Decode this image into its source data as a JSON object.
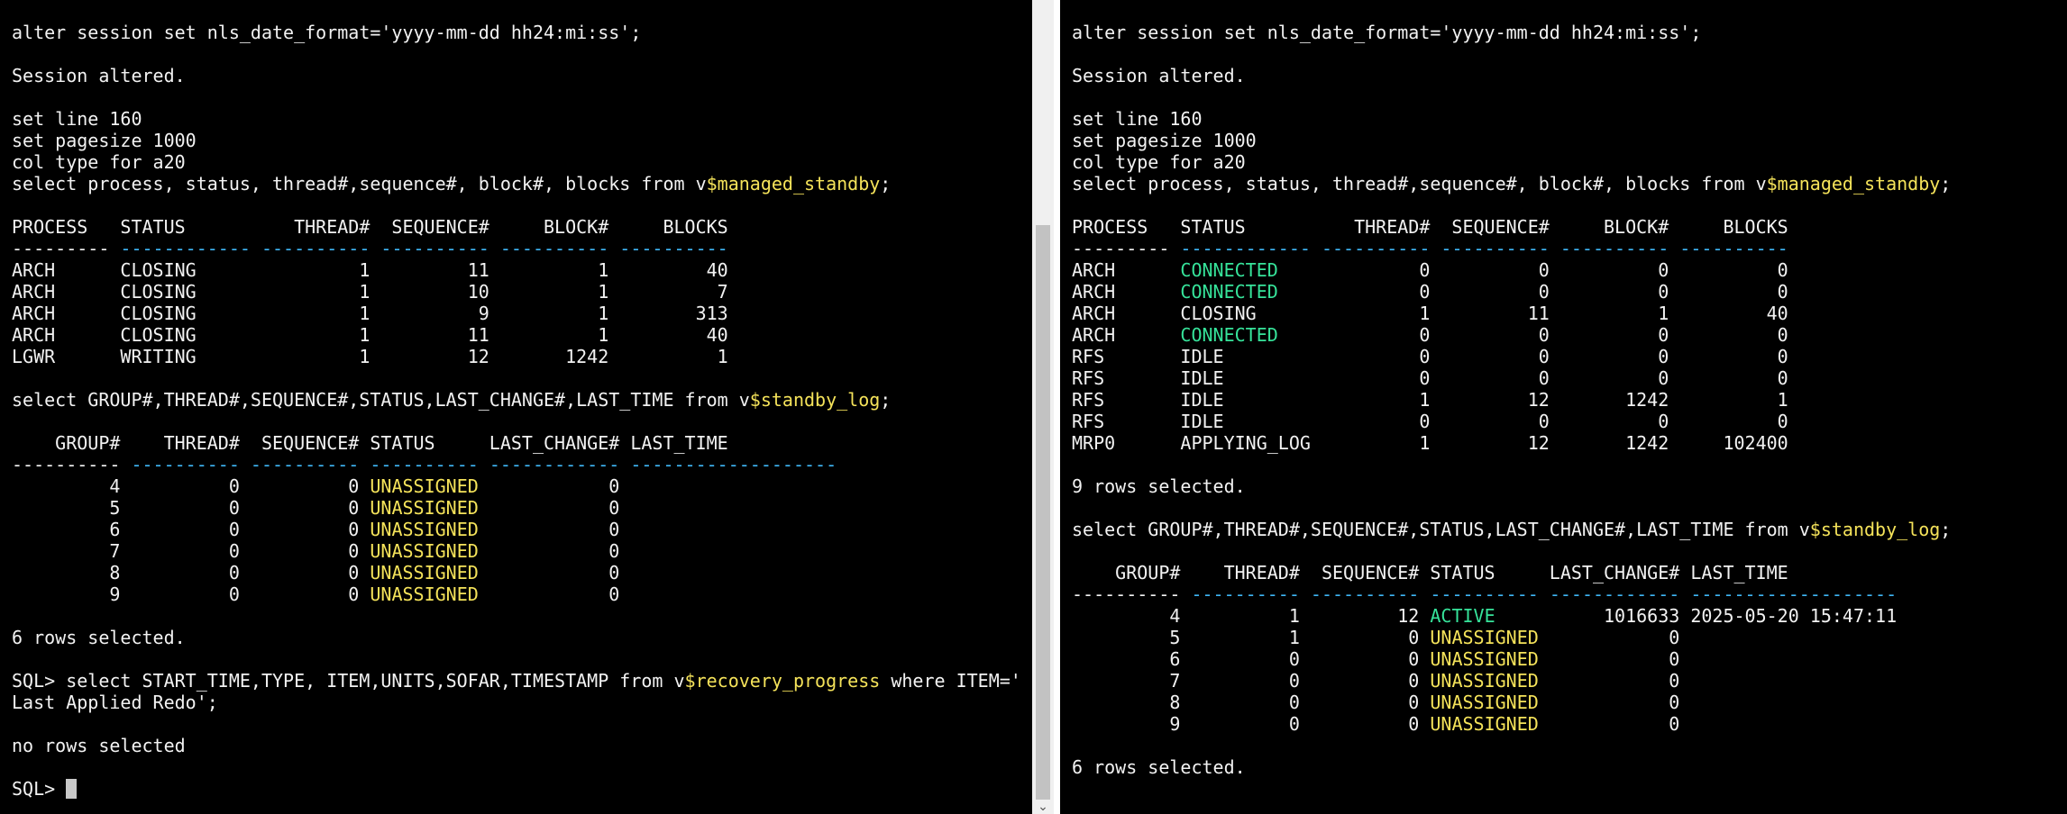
{
  "colors": {
    "background": "#000000",
    "text": "#f2f2f2",
    "highlight_yellow": "#f5e35a",
    "highlight_green": "#36e39a",
    "separator_blue": "#3fb6f5"
  },
  "left_terminal": {
    "lines": [
      [
        {
          "t": "alter session set nls_date_format='yyyy-mm-dd hh24:mi:ss';"
        }
      ],
      [],
      [
        {
          "t": "Session altered."
        }
      ],
      [],
      [
        {
          "t": "set line 160"
        }
      ],
      [
        {
          "t": "set pagesize 1000"
        }
      ],
      [
        {
          "t": "col type for a20"
        }
      ],
      [
        {
          "t": "select process, status, thread#,sequence#, block#, blocks from v"
        },
        {
          "t": "$managed_standby",
          "c": "y"
        },
        {
          "t": ";"
        }
      ],
      [],
      [
        {
          "t": "PROCESS   STATUS          THREAD#  SEQUENCE#     BLOCK#     BLOCKS"
        }
      ],
      [
        {
          "t": "---------"
        },
        {
          "t": " ------------ ---------- ---------- ---------- ----------",
          "c": "d"
        }
      ],
      [
        {
          "t": "ARCH      CLOSING               1         11          1         40"
        }
      ],
      [
        {
          "t": "ARCH      CLOSING               1         10          1          7"
        }
      ],
      [
        {
          "t": "ARCH      CLOSING               1          9          1        313"
        }
      ],
      [
        {
          "t": "ARCH      CLOSING               1         11          1         40"
        }
      ],
      [
        {
          "t": "LGWR      WRITING               1         12       1242          1"
        }
      ],
      [],
      [
        {
          "t": "select GROUP#,THREAD#,SEQUENCE#,STATUS,LAST_CHANGE#,LAST_TIME from v"
        },
        {
          "t": "$standby_log",
          "c": "y"
        },
        {
          "t": ";"
        }
      ],
      [],
      [
        {
          "t": "    GROUP#    THREAD#  SEQUENCE# STATUS     LAST_CHANGE# LAST_TIME"
        }
      ],
      [
        {
          "t": "----------"
        },
        {
          "t": " ---------- ---------- ---------- ------------ -------------------",
          "c": "d"
        }
      ],
      [
        {
          "t": "         4          0          0 "
        },
        {
          "t": "UNASSIGNED",
          "c": "y"
        },
        {
          "t": "            0"
        }
      ],
      [
        {
          "t": "         5          0          0 "
        },
        {
          "t": "UNASSIGNED",
          "c": "y"
        },
        {
          "t": "            0"
        }
      ],
      [
        {
          "t": "         6          0          0 "
        },
        {
          "t": "UNASSIGNED",
          "c": "y"
        },
        {
          "t": "            0"
        }
      ],
      [
        {
          "t": "         7          0          0 "
        },
        {
          "t": "UNASSIGNED",
          "c": "y"
        },
        {
          "t": "            0"
        }
      ],
      [
        {
          "t": "         8          0          0 "
        },
        {
          "t": "UNASSIGNED",
          "c": "y"
        },
        {
          "t": "            0"
        }
      ],
      [
        {
          "t": "         9          0          0 "
        },
        {
          "t": "UNASSIGNED",
          "c": "y"
        },
        {
          "t": "            0"
        }
      ],
      [],
      [
        {
          "t": "6 rows selected."
        }
      ],
      [],
      [
        {
          "t": "SQL> select START_TIME,TYPE, ITEM,UNITS,SOFAR,TIMESTAMP from v"
        },
        {
          "t": "$recovery_progress",
          "c": "y"
        },
        {
          "t": " where ITEM='"
        }
      ],
      [
        {
          "t": "Last Applied Redo';"
        }
      ],
      [],
      [
        {
          "t": "no rows selected"
        }
      ],
      [],
      [
        {
          "t": "SQL> "
        },
        {
          "cursor": true
        }
      ]
    ]
  },
  "right_terminal": {
    "lines": [
      [
        {
          "t": "alter session set nls_date_format='yyyy-mm-dd hh24:mi:ss';"
        }
      ],
      [],
      [
        {
          "t": "Session altered."
        }
      ],
      [],
      [
        {
          "t": "set line 160"
        }
      ],
      [
        {
          "t": "set pagesize 1000"
        }
      ],
      [
        {
          "t": "col type for a20"
        }
      ],
      [
        {
          "t": "select process, status, thread#,sequence#, block#, blocks from v"
        },
        {
          "t": "$managed_standby",
          "c": "y"
        },
        {
          "t": ";"
        }
      ],
      [],
      [
        {
          "t": "PROCESS   STATUS          THREAD#  SEQUENCE#     BLOCK#     BLOCKS"
        }
      ],
      [
        {
          "t": "---------"
        },
        {
          "t": " ------------ ---------- ---------- ---------- ----------",
          "c": "d"
        }
      ],
      [
        {
          "t": "ARCH      "
        },
        {
          "t": "CONNECTED",
          "c": "g"
        },
        {
          "t": "             0          0          0          0"
        }
      ],
      [
        {
          "t": "ARCH      "
        },
        {
          "t": "CONNECTED",
          "c": "g"
        },
        {
          "t": "             0          0          0          0"
        }
      ],
      [
        {
          "t": "ARCH      CLOSING               1         11          1         40"
        }
      ],
      [
        {
          "t": "ARCH      "
        },
        {
          "t": "CONNECTED",
          "c": "g"
        },
        {
          "t": "             0          0          0          0"
        }
      ],
      [
        {
          "t": "RFS       IDLE                  0          0          0          0"
        }
      ],
      [
        {
          "t": "RFS       IDLE                  0          0          0          0"
        }
      ],
      [
        {
          "t": "RFS       IDLE                  1         12       1242          1"
        }
      ],
      [
        {
          "t": "RFS       IDLE                  0          0          0          0"
        }
      ],
      [
        {
          "t": "MRP0      APPLYING_LOG          1         12       1242     102400"
        }
      ],
      [],
      [
        {
          "t": "9 rows selected."
        }
      ],
      [],
      [
        {
          "t": "select GROUP#,THREAD#,SEQUENCE#,STATUS,LAST_CHANGE#,LAST_TIME from v"
        },
        {
          "t": "$standby_log",
          "c": "y"
        },
        {
          "t": ";"
        }
      ],
      [],
      [
        {
          "t": "    GROUP#    THREAD#  SEQUENCE# STATUS     LAST_CHANGE# LAST_TIME"
        }
      ],
      [
        {
          "t": "----------"
        },
        {
          "t": " ---------- ---------- ---------- ------------ -------------------",
          "c": "d"
        }
      ],
      [
        {
          "t": "         4          1         12 "
        },
        {
          "t": "ACTIVE",
          "c": "g"
        },
        {
          "t": "          1016633 2025-05-20 15:47:11"
        }
      ],
      [
        {
          "t": "         5          1          0 "
        },
        {
          "t": "UNASSIGNED",
          "c": "y"
        },
        {
          "t": "            0"
        }
      ],
      [
        {
          "t": "         6          0          0 "
        },
        {
          "t": "UNASSIGNED",
          "c": "y"
        },
        {
          "t": "            0"
        }
      ],
      [
        {
          "t": "         7          0          0 "
        },
        {
          "t": "UNASSIGNED",
          "c": "y"
        },
        {
          "t": "            0"
        }
      ],
      [
        {
          "t": "         8          0          0 "
        },
        {
          "t": "UNASSIGNED",
          "c": "y"
        },
        {
          "t": "            0"
        }
      ],
      [
        {
          "t": "         9          0          0 "
        },
        {
          "t": "UNASSIGNED",
          "c": "y"
        },
        {
          "t": "            0"
        }
      ],
      [],
      [
        {
          "t": "6 rows selected."
        }
      ]
    ]
  },
  "scrollbar": {
    "down_arrow_glyph": "⌄",
    "thumb_fraction_visible": 0.7
  }
}
